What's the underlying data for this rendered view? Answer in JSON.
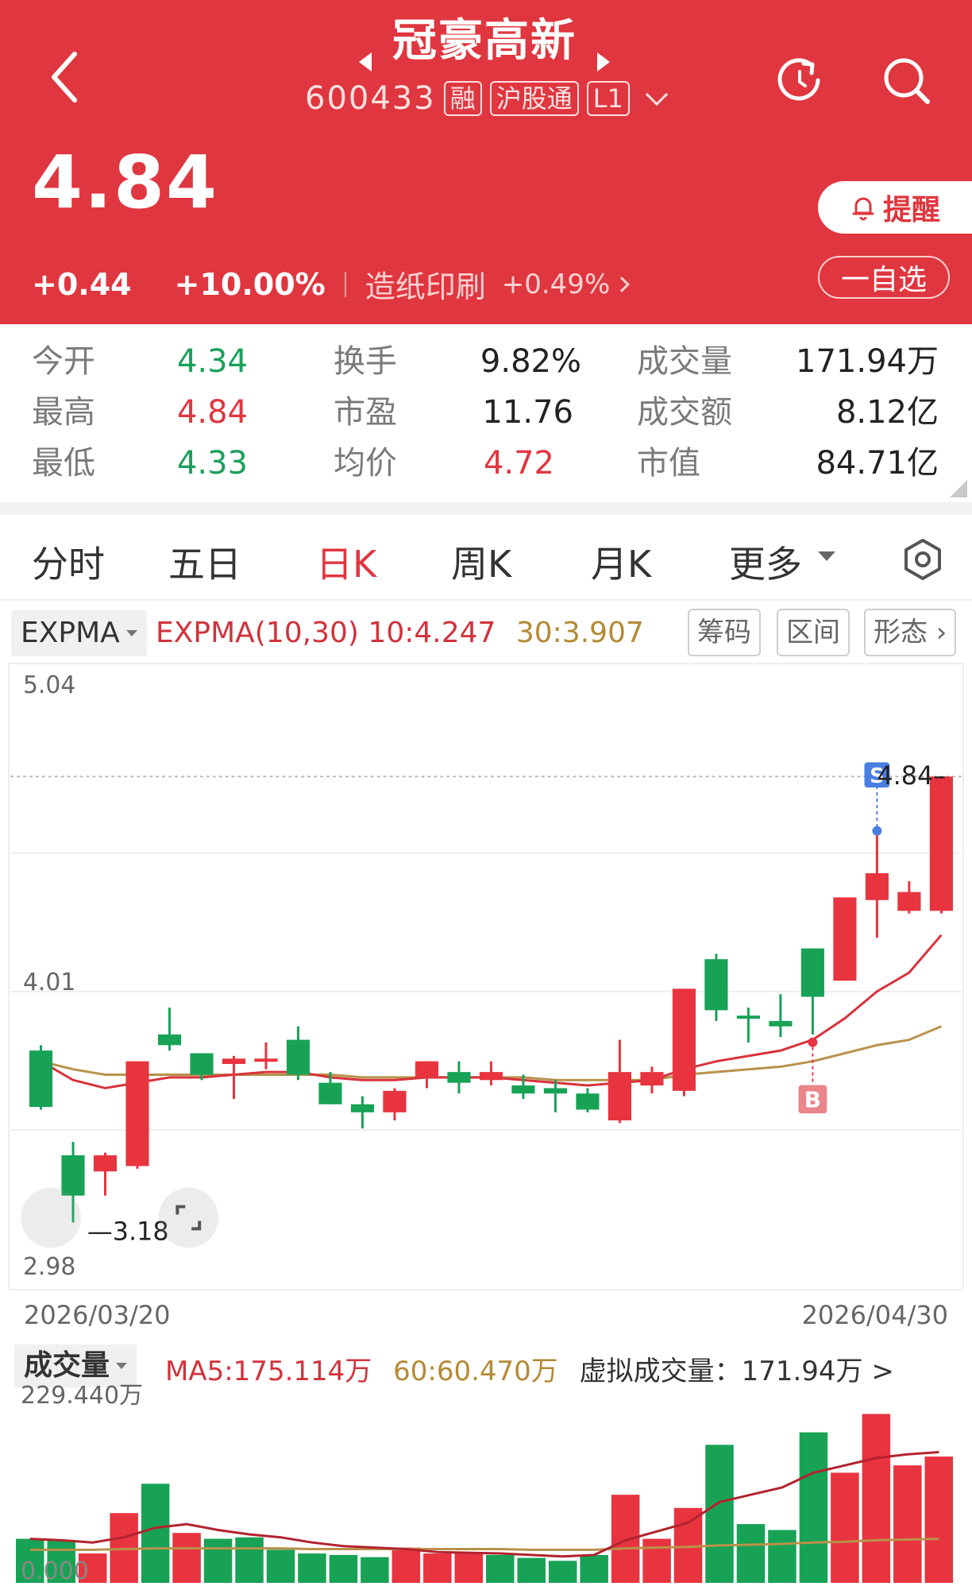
{
  "header": {
    "stock_name": "冠豪高新",
    "code": "600433",
    "tags": [
      "融",
      "沪股通",
      "L1"
    ],
    "price": "4.84",
    "change": "+0.44",
    "change_pct": "+10.00%",
    "sector": "造纸印刷",
    "sector_pct": "+0.49%",
    "alert_label": "提醒",
    "watchlist_label": "一自选",
    "bg_color": "#e0363f"
  },
  "stats": {
    "rows": [
      [
        {
          "label": "今开",
          "value": "4.34",
          "color": "green"
        },
        {
          "label": "换手",
          "value": "9.82%",
          "color": "dark"
        },
        {
          "label": "成交量",
          "value": "171.94万",
          "color": "dark"
        }
      ],
      [
        {
          "label": "最高",
          "value": "4.84",
          "color": "red"
        },
        {
          "label": "市盈",
          "value": "11.76",
          "color": "dark"
        },
        {
          "label": "成交额",
          "value": "8.12亿",
          "color": "dark"
        }
      ],
      [
        {
          "label": "最低",
          "value": "4.33",
          "color": "green"
        },
        {
          "label": "均价",
          "value": "4.72",
          "color": "red"
        },
        {
          "label": "市值",
          "value": "84.71亿",
          "color": "dark"
        }
      ]
    ]
  },
  "tabs": [
    "分时",
    "五日",
    "日K",
    "周K",
    "月K",
    "更多"
  ],
  "active_tab": "日K",
  "indicator": {
    "selector": "EXPMA",
    "label": "EXPMA(10,30)",
    "value10": "10:4.247",
    "value30": "30:3.907",
    "buttons": [
      "筹码",
      "区间",
      "形态"
    ]
  },
  "chart_data": {
    "type": "candlestick",
    "y_max_label": "5.04",
    "y_mid_label": "4.01",
    "y_min_label": "2.98",
    "ylim": [
      2.98,
      5.04
    ],
    "date_start": "2026/03/20",
    "date_end": "2026/04/30",
    "high_marker": "4.84",
    "low_marker": "3.18",
    "signal_sell": "S",
    "signal_buy": "B",
    "up_color": "#e8343f",
    "down_color": "#18a256",
    "candles": [
      {
        "o": 3.82,
        "c": 3.61,
        "h": 3.84,
        "l": 3.6
      },
      {
        "o": 3.43,
        "c": 3.28,
        "h": 3.48,
        "l": 3.18
      },
      {
        "o": 3.37,
        "c": 3.43,
        "h": 3.44,
        "l": 3.28
      },
      {
        "o": 3.39,
        "c": 3.78,
        "h": 3.78,
        "l": 3.38
      },
      {
        "o": 3.88,
        "c": 3.84,
        "h": 3.98,
        "l": 3.82
      },
      {
        "o": 3.81,
        "c": 3.73,
        "h": 3.81,
        "l": 3.71
      },
      {
        "o": 3.77,
        "c": 3.79,
        "h": 3.8,
        "l": 3.64
      },
      {
        "o": 3.79,
        "c": 3.79,
        "h": 3.85,
        "l": 3.75
      },
      {
        "o": 3.86,
        "c": 3.73,
        "h": 3.91,
        "l": 3.71
      },
      {
        "o": 3.7,
        "c": 3.62,
        "h": 3.74,
        "l": 3.62
      },
      {
        "o": 3.62,
        "c": 3.59,
        "h": 3.65,
        "l": 3.53
      },
      {
        "o": 3.59,
        "c": 3.67,
        "h": 3.68,
        "l": 3.56
      },
      {
        "o": 3.72,
        "c": 3.78,
        "h": 3.78,
        "l": 3.68
      },
      {
        "o": 3.74,
        "c": 3.7,
        "h": 3.78,
        "l": 3.66
      },
      {
        "o": 3.71,
        "c": 3.74,
        "h": 3.78,
        "l": 3.69
      },
      {
        "o": 3.69,
        "c": 3.66,
        "h": 3.73,
        "l": 3.64
      },
      {
        "o": 3.68,
        "c": 3.66,
        "h": 3.71,
        "l": 3.59
      },
      {
        "o": 3.66,
        "c": 3.6,
        "h": 3.68,
        "l": 3.59
      },
      {
        "o": 3.56,
        "c": 3.74,
        "h": 3.86,
        "l": 3.55
      },
      {
        "o": 3.69,
        "c": 3.74,
        "h": 3.76,
        "l": 3.66
      },
      {
        "o": 3.67,
        "c": 4.05,
        "h": 4.05,
        "l": 3.65
      },
      {
        "o": 4.16,
        "c": 3.97,
        "h": 4.18,
        "l": 3.93
      },
      {
        "o": 3.95,
        "c": 3.94,
        "h": 3.98,
        "l": 3.85
      },
      {
        "o": 3.93,
        "c": 3.91,
        "h": 4.03,
        "l": 3.87
      },
      {
        "o": 4.2,
        "c": 4.02,
        "h": 4.2,
        "l": 3.88
      },
      {
        "o": 4.08,
        "c": 4.39,
        "h": 4.39,
        "l": 4.08
      },
      {
        "o": 4.38,
        "c": 4.48,
        "h": 4.62,
        "l": 4.24
      },
      {
        "o": 4.34,
        "c": 4.41,
        "h": 4.45,
        "l": 4.33
      },
      {
        "o": 4.34,
        "c": 4.84,
        "h": 4.84,
        "l": 4.33
      }
    ],
    "ema10": [
      3.78,
      3.71,
      3.68,
      3.7,
      3.72,
      3.72,
      3.73,
      3.74,
      3.74,
      3.72,
      3.71,
      3.71,
      3.72,
      3.72,
      3.72,
      3.71,
      3.7,
      3.69,
      3.7,
      3.71,
      3.75,
      3.78,
      3.8,
      3.82,
      3.86,
      3.94,
      4.04,
      4.11,
      4.25
    ],
    "ema30": [
      3.78,
      3.75,
      3.73,
      3.73,
      3.73,
      3.73,
      3.73,
      3.73,
      3.73,
      3.73,
      3.72,
      3.72,
      3.72,
      3.72,
      3.72,
      3.72,
      3.71,
      3.71,
      3.71,
      3.71,
      3.73,
      3.74,
      3.75,
      3.76,
      3.78,
      3.81,
      3.84,
      3.86,
      3.91
    ]
  },
  "volume": {
    "selector": "成交量",
    "ma5": "MA5:175.114万",
    "ma60": "60:60.470万",
    "virtual": "虚拟成交量：171.94万 >",
    "max_label": "229.440万",
    "min_label": "0.000",
    "ylim": [
      0,
      229.44
    ],
    "bars": [
      60,
      58,
      40,
      95,
      135,
      68,
      60,
      62,
      45,
      40,
      38,
      35,
      48,
      40,
      42,
      38,
      34,
      30,
      38,
      120,
      60,
      102,
      188,
      80,
      72,
      205,
      150,
      230,
      160,
      172
    ],
    "ma5_line": [
      60,
      58,
      55,
      62,
      75,
      80,
      72,
      66,
      62,
      55,
      50,
      48,
      46,
      42,
      41,
      40,
      38,
      36,
      38,
      58,
      70,
      82,
      110,
      120,
      130,
      150,
      160,
      170,
      175,
      178
    ],
    "ma60_line": [
      45,
      45,
      45,
      46,
      47,
      47,
      47,
      47,
      47,
      46,
      46,
      46,
      46,
      46,
      46,
      46,
      45,
      45,
      45,
      47,
      48,
      49,
      51,
      52,
      53,
      55,
      56,
      58,
      59,
      60
    ]
  }
}
